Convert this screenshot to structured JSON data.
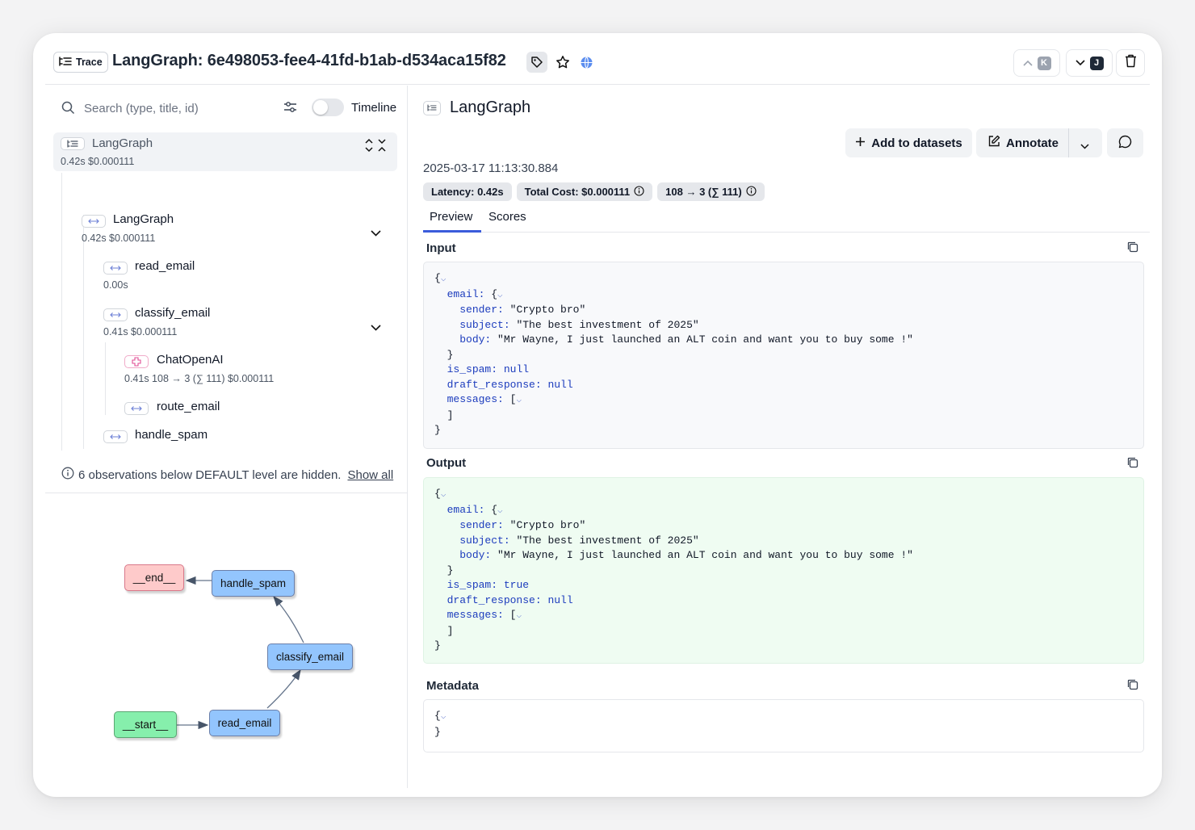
{
  "header": {
    "trace_badge": "Trace",
    "title": "LangGraph: 6e498053-fee4-41fd-b1ab-d534aca15f82",
    "prev_key": "K",
    "next_key": "J"
  },
  "left": {
    "search_placeholder": "Search (type, title, id)",
    "timeline_label": "Timeline",
    "tree": {
      "root": {
        "name": "LangGraph",
        "meta": "0.42s  $0.000111"
      },
      "langgraph": {
        "name": "LangGraph",
        "meta": "0.42s  $0.000111"
      },
      "read_email": {
        "name": "read_email",
        "meta": "0.00s"
      },
      "classify_email": {
        "name": "classify_email",
        "meta": "0.41s  $0.000111"
      },
      "chatopenai": {
        "name": "ChatOpenAI",
        "meta": "0.41s  108 → 3 (∑ 111)  $0.000111"
      },
      "route_email": {
        "name": "route_email"
      },
      "handle_spam": {
        "name": "handle_spam"
      }
    },
    "hidden_notice": "6 observations below DEFAULT level are hidden.",
    "show_all": "Show all",
    "graph_nodes": {
      "end": "__end__",
      "handle_spam": "handle_spam",
      "classify_email": "classify_email",
      "start": "__start__",
      "read_email": "read_email"
    },
    "graph_colors": {
      "end": "#fecaca",
      "start": "#86efac",
      "node": "#93c5fd"
    }
  },
  "right": {
    "title": "LangGraph",
    "add_to_datasets": "Add to datasets",
    "annotate": "Annotate",
    "timestamp": "2025-03-17 11:13:30.884",
    "latency": "Latency: 0.42s",
    "total_cost": "Total Cost: $0.000111",
    "tokens": "108 → 3 (∑ 111)",
    "tabs": [
      "Preview",
      "Scores"
    ],
    "sections": {
      "input": "Input",
      "output": "Output",
      "metadata": "Metadata"
    },
    "input": {
      "sender": "\"Crypto bro\"",
      "subject": "\"The best investment of 2025\"",
      "body": "\"Mr Wayne, I just launched an ALT coin and want you to buy some !\"",
      "is_spam": "null",
      "draft_response": "null"
    },
    "output": {
      "sender": "\"Crypto bro\"",
      "subject": "\"The best investment of 2025\"",
      "body": "\"Mr Wayne, I just launched an ALT coin and want you to buy some !\"",
      "is_spam": "true",
      "draft_response": "null"
    },
    "accent_color": "#3b5bdb"
  }
}
